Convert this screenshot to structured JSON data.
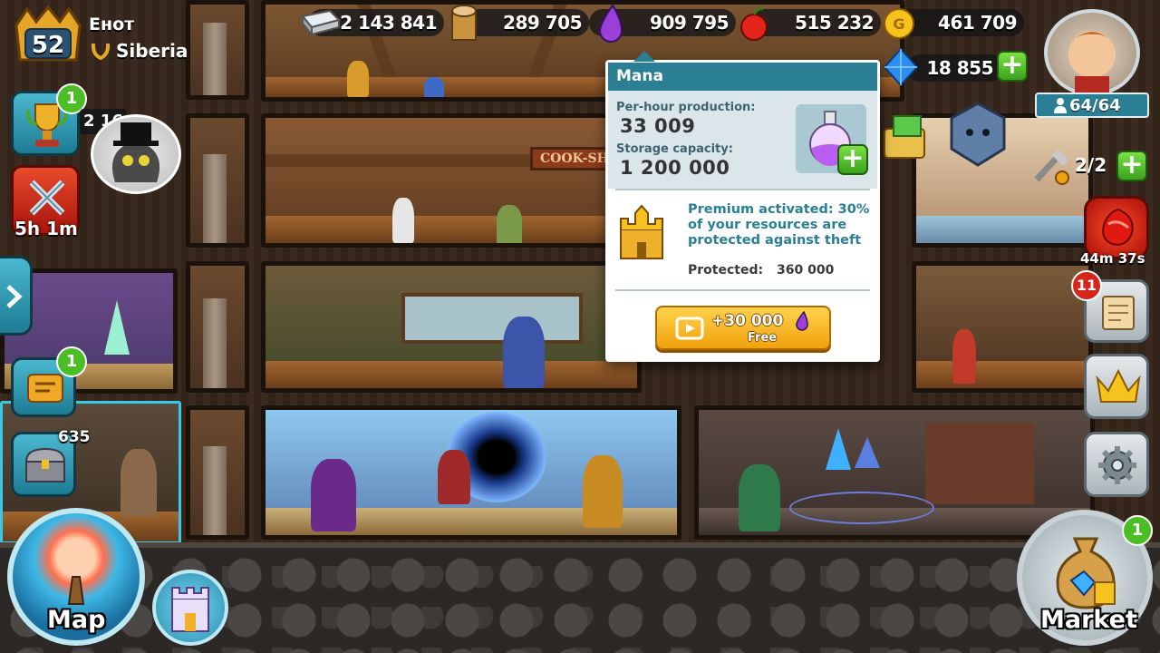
{
  "player": {
    "level": "52",
    "name": "Енот",
    "location": "Siberia"
  },
  "resources": {
    "iron": "2 143 841",
    "wood": "289 705",
    "mana": "909 795",
    "food": "515 232",
    "gold": "461 709",
    "gems": "18 855"
  },
  "population": "64/64",
  "builders": "2/2",
  "left": {
    "quests_badge": "1",
    "quests_value": "2 16",
    "raid_timer": "5h 1m",
    "scroll_badge": "1",
    "chest_badge": "635"
  },
  "right": {
    "event_timer": "44m 37s",
    "letters_badge": "11",
    "market_badge": "1"
  },
  "buttons": {
    "map": "Map",
    "market": "Market"
  },
  "room_sign": "COOK-SHO",
  "popup": {
    "title": "Mana",
    "production_label": "Per-hour production:",
    "production_value": "33 009",
    "capacity_label": "Storage capacity:",
    "capacity_value": "1 200 000",
    "premium_text": "Premium activated: 30% of your resources are protected against theft",
    "protected_label": "Protected:",
    "protected_value": "360 000",
    "reward_amount": "+30 000",
    "reward_label": "Free"
  },
  "colors": {
    "accent_teal": "#2a7f95",
    "gold_button": "#f0a10e",
    "green_plus": "#4cbe25",
    "red_badge": "#d4261c"
  }
}
